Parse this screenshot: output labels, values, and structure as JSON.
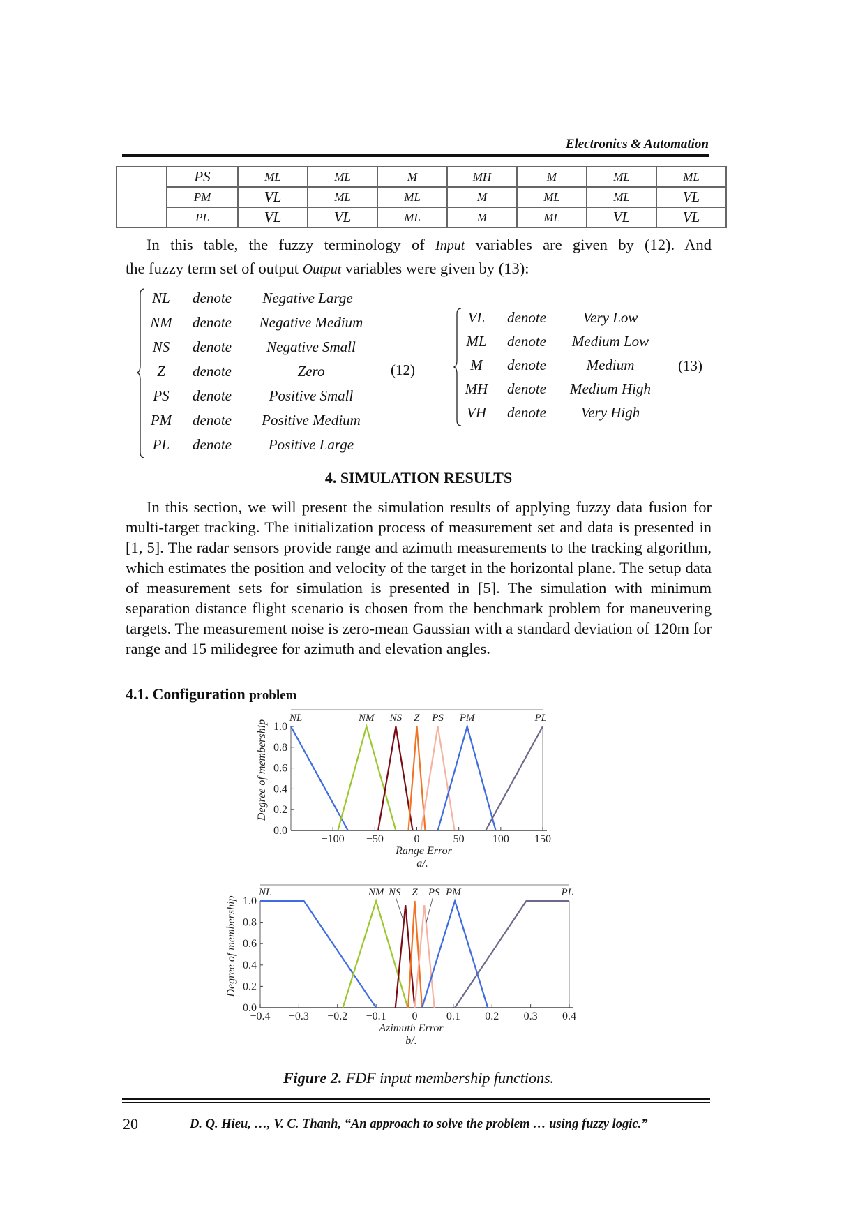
{
  "header": {
    "journal_section": "Electronics & Automation"
  },
  "rule_table": {
    "rows": [
      {
        "label": "PS",
        "values": [
          "ML",
          "ML",
          "M",
          "MH",
          "M",
          "ML",
          "ML"
        ]
      },
      {
        "label": "PM",
        "values": [
          "VL",
          "ML",
          "ML",
          "M",
          "ML",
          "ML",
          "VL"
        ]
      },
      {
        "label": "PL",
        "values": [
          "VL",
          "VL",
          "ML",
          "M",
          "ML",
          "VL",
          "VL"
        ]
      }
    ]
  },
  "paragraph1": {
    "line1_a": "In this table, the fuzzy terminology of ",
    "line1_italic": "Input",
    "line1_b": " variables are given by (12). And",
    "line2_a": "the fuzzy term set of output ",
    "line2_italic": "Output",
    "line2_b": " variables were given by (13):"
  },
  "equation12": {
    "number": "(12)",
    "rows": [
      {
        "symbol": "NL",
        "verb": "denote",
        "meaning": "Negative Large"
      },
      {
        "symbol": "NM",
        "verb": "denote",
        "meaning": "Negative Medium"
      },
      {
        "symbol": "NS",
        "verb": "denote",
        "meaning": "Negative Small"
      },
      {
        "symbol": "Z",
        "verb": "denote",
        "meaning": "Zero"
      },
      {
        "symbol": "PS",
        "verb": "denote",
        "meaning": "Positive Small"
      },
      {
        "symbol": "PM",
        "verb": "denote",
        "meaning": "Positive Medium"
      },
      {
        "symbol": "PL",
        "verb": "denote",
        "meaning": "Positive Large"
      }
    ]
  },
  "equation13": {
    "number": "(13)",
    "rows": [
      {
        "symbol": "VL",
        "verb": "denote",
        "meaning": "Very Low"
      },
      {
        "symbol": "ML",
        "verb": "denote",
        "meaning": "Medium Low"
      },
      {
        "symbol": "M",
        "verb": "denote",
        "meaning": "Medium"
      },
      {
        "symbol": "MH",
        "verb": "denote",
        "meaning": "Medium High"
      },
      {
        "symbol": "VH",
        "verb": "denote",
        "meaning": "Very High"
      }
    ]
  },
  "section": {
    "title": "4. SIMULATION RESULTS",
    "body": "In this section, we will present the simulation results of applying fuzzy data fusion for multi-target tracking. The initialization process of measurement set and data is presented in [1, 5]. The radar sensors provide range and azimuth measurements to the tracking algorithm, which estimates the position and velocity of the target in the horizontal plane. The setup data of measurement sets for simulation is presented in [5]. The simulation with minimum separation distance flight scenario is chosen from the benchmark problem for maneuvering targets. The measurement noise is zero-mean Gaussian with a standard deviation of 120m for range and 15 milidegree for azimuth and elevation angles.",
    "subsection_a": "4.1. Configuration ",
    "subsection_b": "problem"
  },
  "chart_data": [
    {
      "type": "line",
      "title": "",
      "xlabel": "Range Error",
      "sublabel": "a/.",
      "ylabel": "Degree of membership",
      "xlim": [
        -150,
        150
      ],
      "ylim": [
        0,
        1
      ],
      "xticks": [
        -100,
        -50,
        0,
        50,
        100,
        150
      ],
      "xtick_labels": [
        "−100",
        "−50",
        "0",
        "50",
        "100",
        "150"
      ],
      "yticks": [
        0.0,
        0.2,
        0.4,
        0.6,
        0.8,
        1.0
      ],
      "ytick_labels": [
        "0.0",
        "0.2",
        "0.4",
        "0.6",
        "0.8",
        "1.0"
      ],
      "grid": false,
      "series": [
        {
          "name": "NL",
          "color": "#3f6ce0",
          "x": [
            -150,
            -82
          ],
          "y": [
            1,
            0
          ]
        },
        {
          "name": "NM",
          "color": "#9cc82e",
          "x": [
            -94,
            -60,
            -25
          ],
          "y": [
            0,
            1,
            0
          ]
        },
        {
          "name": "NS",
          "color": "#7a0c14",
          "x": [
            -46,
            -25,
            -5
          ],
          "y": [
            0,
            1,
            0
          ]
        },
        {
          "name": "Z",
          "color": "#f27322",
          "x": [
            -10,
            0,
            10
          ],
          "y": [
            0,
            1,
            0
          ]
        },
        {
          "name": "PS",
          "color": "#f5b4a2",
          "x": [
            5,
            25,
            45
          ],
          "y": [
            0,
            1,
            0
          ]
        },
        {
          "name": "PM",
          "color": "#3f6ce0",
          "x": [
            25,
            60,
            94
          ],
          "y": [
            0,
            1,
            0
          ]
        },
        {
          "name": "PL",
          "color": "#6b6a8c",
          "x": [
            82,
            150
          ],
          "y": [
            0,
            1
          ]
        }
      ],
      "series_labels": [
        {
          "name": "NL",
          "x": -144
        },
        {
          "name": "NM",
          "x": -60
        },
        {
          "name": "NS",
          "x": -25
        },
        {
          "name": "Z",
          "x": 0
        },
        {
          "name": "PS",
          "x": 25
        },
        {
          "name": "PM",
          "x": 60
        },
        {
          "name": "PL",
          "x": 150
        }
      ]
    },
    {
      "type": "line",
      "title": "",
      "xlabel": "Azimuth Error",
      "sublabel": "b/.",
      "ylabel": "Degree of membership",
      "xlim": [
        -0.4,
        0.4
      ],
      "ylim": [
        0,
        1
      ],
      "xticks": [
        -0.4,
        -0.3,
        -0.2,
        -0.1,
        0,
        0.1,
        0.2,
        0.3,
        0.4
      ],
      "xtick_labels": [
        "−0.4",
        "−0.3",
        "−0.2",
        "−0.1",
        "0",
        "0.1",
        "0.2",
        "0.3",
        "0.4"
      ],
      "yticks": [
        0.0,
        0.2,
        0.4,
        0.6,
        0.8,
        1.0
      ],
      "ytick_labels": [
        "0.0",
        "0.2",
        "0.4",
        "0.6",
        "0.8",
        "1.0"
      ],
      "grid": false,
      "series": [
        {
          "name": "NL",
          "color": "#3f6ce0",
          "x": [
            -0.4,
            -0.287,
            -0.1
          ],
          "y": [
            1,
            1,
            0
          ]
        },
        {
          "name": "NM",
          "color": "#9cc82e",
          "x": [
            -0.186,
            -0.1,
            -0.018
          ],
          "y": [
            0,
            1,
            0
          ]
        },
        {
          "name": "NS",
          "color": "#7a0c14",
          "x": [
            -0.05,
            -0.024,
            0.0
          ],
          "y": [
            0,
            0.96,
            0
          ]
        },
        {
          "name": "Z",
          "color": "#f27322",
          "x": [
            -0.017,
            0.0,
            0.019
          ],
          "y": [
            0,
            1,
            0
          ]
        },
        {
          "name": "PS",
          "color": "#f5b4a2",
          "x": [
            0.0,
            0.025,
            0.051
          ],
          "y": [
            0,
            0.96,
            0
          ]
        },
        {
          "name": "PM",
          "color": "#3f6ce0",
          "x": [
            0.019,
            0.104,
            0.189
          ],
          "y": [
            0,
            1,
            0
          ]
        },
        {
          "name": "PL",
          "color": "#6b6a8c",
          "x": [
            0.104,
            0.289,
            0.4
          ],
          "y": [
            0,
            1,
            1
          ]
        }
      ],
      "series_labels": [
        {
          "name": "NL",
          "x": -0.39
        },
        {
          "name": "NM",
          "x": -0.1
        },
        {
          "name": "NS",
          "x": -0.052,
          "leader_to": [
            -0.028,
            0.8
          ]
        },
        {
          "name": "Z",
          "x": 0.0
        },
        {
          "name": "PS",
          "x": 0.05,
          "leader_to": [
            0.03,
            0.8
          ]
        },
        {
          "name": "PM",
          "x": 0.1
        },
        {
          "name": "PL",
          "x": 0.4
        }
      ]
    }
  ],
  "caption": {
    "label": "Figure 2.",
    "text": " FDF input membership functions."
  },
  "footer": {
    "page_number": "20",
    "citation": "D. Q. Hieu, …, V. C. Thanh, “An approach to solve the problem … using fuzzy logic.”"
  }
}
